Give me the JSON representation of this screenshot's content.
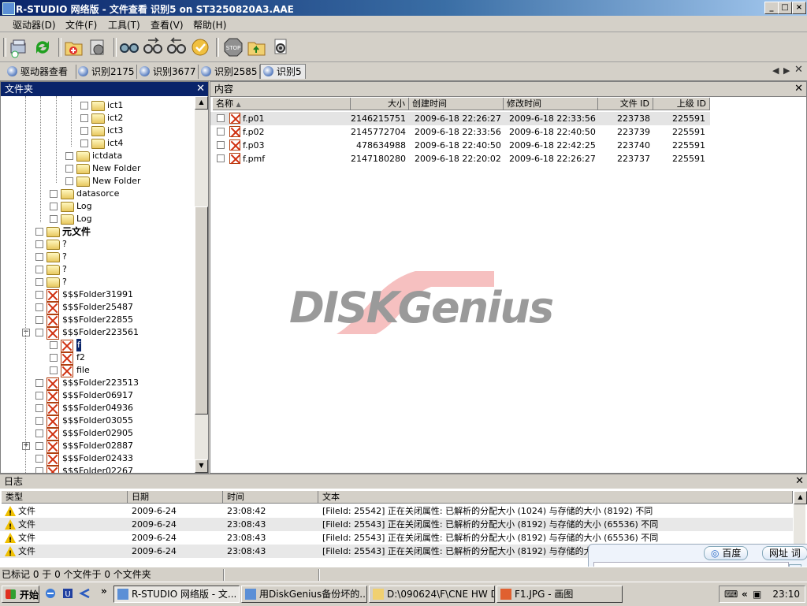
{
  "window": {
    "title": "R-STUDIO 网络版 - 文件查看 识别5 on ST3250820A3.AAE"
  },
  "menu": [
    "驱动器(D)",
    "文件(F)",
    "工具(T)",
    "查看(V)",
    "帮助(H)"
  ],
  "toolbar": [
    {
      "icon": "drive-scan-icon"
    },
    {
      "icon": "refresh-icon"
    },
    {
      "icon": "add-image-icon"
    },
    {
      "icon": "create-region-icon"
    },
    {
      "icon": "find-icon"
    },
    {
      "icon": "find-next-icon"
    },
    {
      "icon": "find-previous-icon"
    },
    {
      "icon": "mark-icon"
    },
    {
      "icon": "stop-icon"
    },
    {
      "icon": "open-folder-icon"
    },
    {
      "icon": "preview-icon"
    }
  ],
  "tabs": [
    "驱动器查看",
    "识别2175",
    "识别3677",
    "识别2585",
    "识别5"
  ],
  "folderPane": {
    "title": "文件夹",
    "tree": [
      {
        "label": "ict1",
        "icon": "folder",
        "level": 5
      },
      {
        "label": "ict2",
        "icon": "folder",
        "level": 5
      },
      {
        "label": "ict3",
        "icon": "folder",
        "level": 5
      },
      {
        "label": "ict4",
        "icon": "folder",
        "level": 5
      },
      {
        "label": "ictdata",
        "icon": "folder",
        "level": 4
      },
      {
        "label": "New Folder",
        "icon": "folder",
        "level": 4
      },
      {
        "label": "New Folder",
        "icon": "folder",
        "level": 4
      },
      {
        "label": "datasorce",
        "icon": "folder",
        "level": 3
      },
      {
        "label": "Log",
        "icon": "folder",
        "level": 3
      },
      {
        "label": "Log",
        "icon": "folder",
        "level": 3
      },
      {
        "label": "元文件",
        "icon": "folder",
        "level": 2,
        "bold": true
      },
      {
        "label": "?",
        "icon": "folder",
        "level": 2
      },
      {
        "label": "?",
        "icon": "folder",
        "level": 2
      },
      {
        "label": "?",
        "icon": "folder",
        "level": 2
      },
      {
        "label": "?",
        "icon": "folder",
        "level": 2
      },
      {
        "label": "$$$Folder31991",
        "icon": "deleted",
        "level": 2
      },
      {
        "label": "$$$Folder25487",
        "icon": "deleted",
        "level": 2
      },
      {
        "label": "$$$Folder22855",
        "icon": "deleted",
        "level": 2
      },
      {
        "label": "$$$Folder223561",
        "icon": "deleted",
        "level": 2,
        "expanded": true
      },
      {
        "label": "f",
        "icon": "deleted",
        "level": 3,
        "selected": true
      },
      {
        "label": "f2",
        "icon": "deleted",
        "level": 3
      },
      {
        "label": "file",
        "icon": "deleted",
        "level": 3
      },
      {
        "label": "$$$Folder223513",
        "icon": "deleted",
        "level": 2
      },
      {
        "label": "$$$Folder06917",
        "icon": "deleted",
        "level": 2
      },
      {
        "label": "$$$Folder04936",
        "icon": "deleted",
        "level": 2
      },
      {
        "label": "$$$Folder03055",
        "icon": "deleted",
        "level": 2
      },
      {
        "label": "$$$Folder02905",
        "icon": "deleted",
        "level": 2
      },
      {
        "label": "$$$Folder02887",
        "icon": "deleted",
        "level": 2,
        "collapsed": true
      },
      {
        "label": "$$$Folder02433",
        "icon": "deleted",
        "level": 2
      },
      {
        "label": "$$$Folder02267",
        "icon": "deleted",
        "level": 2
      }
    ]
  },
  "contentPane": {
    "title": "内容",
    "columns": [
      "名称",
      "大小",
      "创建时间",
      "修改时间",
      "文件 ID",
      "上级 ID"
    ],
    "rows": [
      {
        "name": "f.p01",
        "size": "2146215751",
        "created": "2009-6-18 22:26:27",
        "modified": "2009-6-18 22:33:56",
        "fid": "223738",
        "pid": "225591",
        "selected": true
      },
      {
        "name": "f.p02",
        "size": "2145772704",
        "created": "2009-6-18 22:33:56",
        "modified": "2009-6-18 22:40:50",
        "fid": "223739",
        "pid": "225591"
      },
      {
        "name": "f.p03",
        "size": "478634988",
        "created": "2009-6-18 22:40:50",
        "modified": "2009-6-18 22:42:25",
        "fid": "223740",
        "pid": "225591"
      },
      {
        "name": "f.pmf",
        "size": "2147180280",
        "created": "2009-6-18 22:20:02",
        "modified": "2009-6-18 22:26:27",
        "fid": "223737",
        "pid": "225591"
      }
    ],
    "watermark": "DISKGenius"
  },
  "logPane": {
    "title": "日志",
    "columns": [
      "类型",
      "日期",
      "时间",
      "文本"
    ],
    "rows": [
      {
        "type": "文件",
        "date": "2009-6-24",
        "time": "23:08:42",
        "text": "[FileId: 25542] 正在关闭属性: 已解析的分配大小 (1024) 与存储的大小 (8192) 不同"
      },
      {
        "type": "文件",
        "date": "2009-6-24",
        "time": "23:08:43",
        "text": "[FileId: 25543] 正在关闭属性: 已解析的分配大小 (8192) 与存储的大小 (65536) 不同"
      },
      {
        "type": "文件",
        "date": "2009-6-24",
        "time": "23:08:43",
        "text": "[FileId: 25543] 正在关闭属性: 已解析的分配大小 (8192) 与存储的大小 (65536) 不同"
      },
      {
        "type": "文件",
        "date": "2009-6-24",
        "time": "23:08:43",
        "text": "[FileId: 25543] 正在关闭属性: 已解析的分配大小 (8192) 与存储的大小"
      }
    ]
  },
  "status": {
    "text": "已标记 0 于 0 个文件于 0 个文件夹"
  },
  "taskbar": {
    "start": "开始",
    "tasks": [
      {
        "label": "R-STUDIO 网络版 - 文...",
        "active": true
      },
      {
        "label": "用DiskGenius备份坏的..."
      },
      {
        "label": "D:\\090624\\F\\CNE HW D..."
      },
      {
        "label": "F1.JPG - 画图"
      }
    ],
    "clock": "23:10"
  },
  "baidu": {
    "search": "百度",
    "url": "网址",
    "word": "词"
  }
}
